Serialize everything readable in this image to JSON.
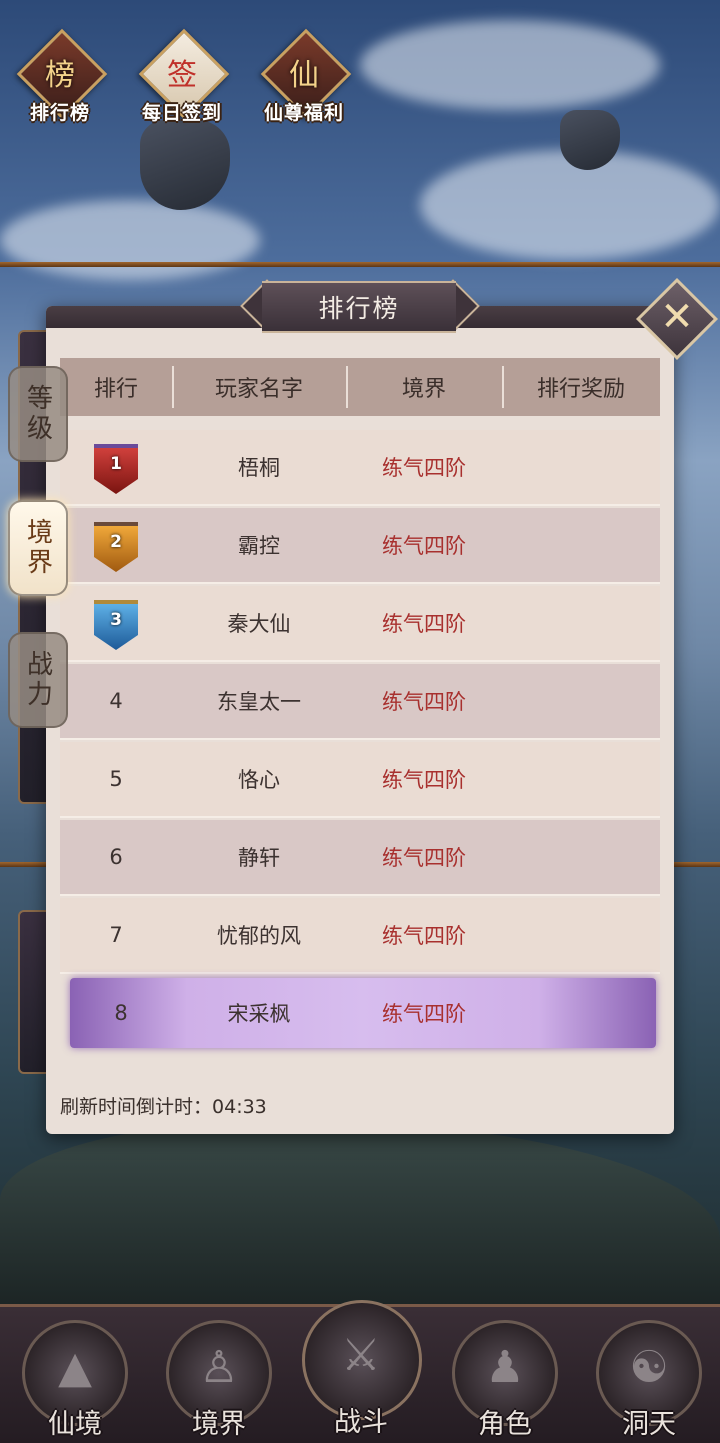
{
  "top_icons": [
    {
      "glyph": "榜",
      "label": "排行榜"
    },
    {
      "glyph": "签",
      "label": "每日签到"
    },
    {
      "glyph": "仙",
      "label": "仙尊福利"
    }
  ],
  "side_tabs": [
    {
      "label": "等级",
      "active": false
    },
    {
      "label": "境界",
      "active": true
    },
    {
      "label": "战力",
      "active": false
    }
  ],
  "panel": {
    "title": "排行榜",
    "close_glyph": "✕",
    "columns": [
      "排行",
      "玩家名字",
      "境界",
      "排行奖励"
    ],
    "rows": [
      {
        "rank": "1",
        "name": "梧桐",
        "realm": "练气四阶",
        "reward": "",
        "medal_color": "#b0221f"
      },
      {
        "rank": "2",
        "name": "霸控",
        "realm": "练气四阶",
        "reward": "",
        "medal_color": "#d98a1e"
      },
      {
        "rank": "3",
        "name": "秦大仙",
        "realm": "练气四阶",
        "reward": "",
        "medal_color": "#3f8fd0"
      },
      {
        "rank": "4",
        "name": "东皇太一",
        "realm": "练气四阶",
        "reward": ""
      },
      {
        "rank": "5",
        "name": "恪心",
        "realm": "练气四阶",
        "reward": ""
      },
      {
        "rank": "6",
        "name": "静轩",
        "realm": "练气四阶",
        "reward": ""
      },
      {
        "rank": "7",
        "name": "忧郁的风",
        "realm": "练气四阶",
        "reward": ""
      },
      {
        "rank": "8",
        "name": "宋采枫",
        "realm": "练气四阶",
        "reward": "",
        "is_self": true
      }
    ],
    "footer_label": "刷新时间倒计时：",
    "footer_time": "04:33"
  },
  "bottom_nav": [
    {
      "label": "仙境",
      "icon": "mountain-icon"
    },
    {
      "label": "境界",
      "icon": "meditation-icon"
    },
    {
      "label": "战斗",
      "icon": "crossed-swords-icon"
    },
    {
      "label": "角色",
      "icon": "character-icon"
    },
    {
      "label": "洞天",
      "icon": "triskelion-icon"
    }
  ]
}
